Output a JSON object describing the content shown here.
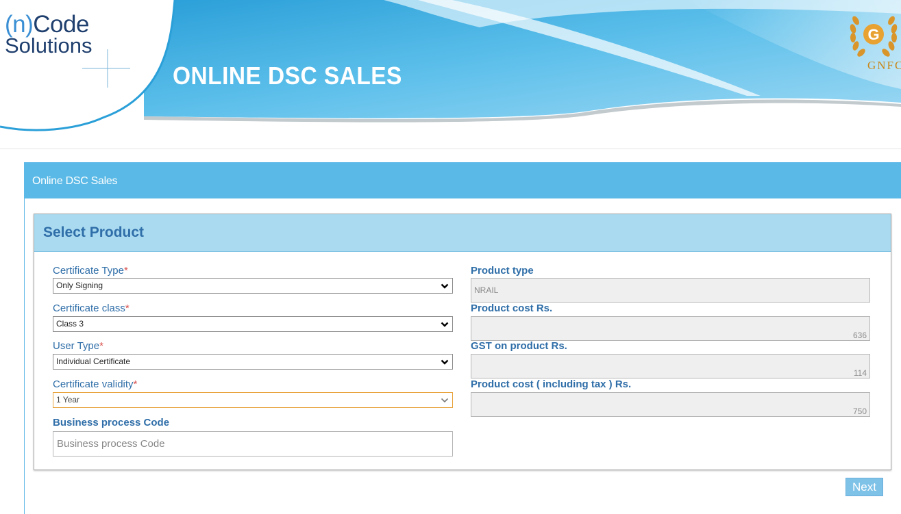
{
  "header": {
    "logo_line1_paren": "(n)",
    "logo_line1_rest": "Code",
    "logo_line2": "Solutions",
    "site_title": "ONLINE DSC SALES",
    "partner_logo_text": "GNFC",
    "partner_logo_letter": "G"
  },
  "panel": {
    "heading": "Online DSC Sales"
  },
  "product_section": {
    "heading": "Select Product",
    "required_mark": "*",
    "certificate_type": {
      "label": "Certificate Type",
      "value": "Only Signing"
    },
    "certificate_class": {
      "label": "Certificate class",
      "value": "Class 3"
    },
    "user_type": {
      "label": "User Type",
      "value": "Individual Certificate"
    },
    "certificate_validity": {
      "label": "Certificate validity",
      "value": "1 Year"
    },
    "business_process_code": {
      "label": "Business process Code",
      "placeholder": "Business process Code"
    },
    "product_type": {
      "label": "Product type",
      "value": "NRAIL"
    },
    "product_cost": {
      "label": "Product cost Rs.",
      "value": "636"
    },
    "gst_on_product": {
      "label": "GST on product Rs.",
      "value": "114"
    },
    "product_cost_incl_tax": {
      "label": "Product cost ( including tax ) Rs.",
      "value": "750"
    }
  },
  "actions": {
    "next_label": "Next"
  },
  "colors": {
    "header_blue": "#5ab9e6",
    "label_blue": "#2f6ea8",
    "required_red": "#d9534f",
    "section_heading_bg": "#a9daf0",
    "next_button": "#7ec2e8",
    "gnfc_gold": "#c9871a"
  }
}
